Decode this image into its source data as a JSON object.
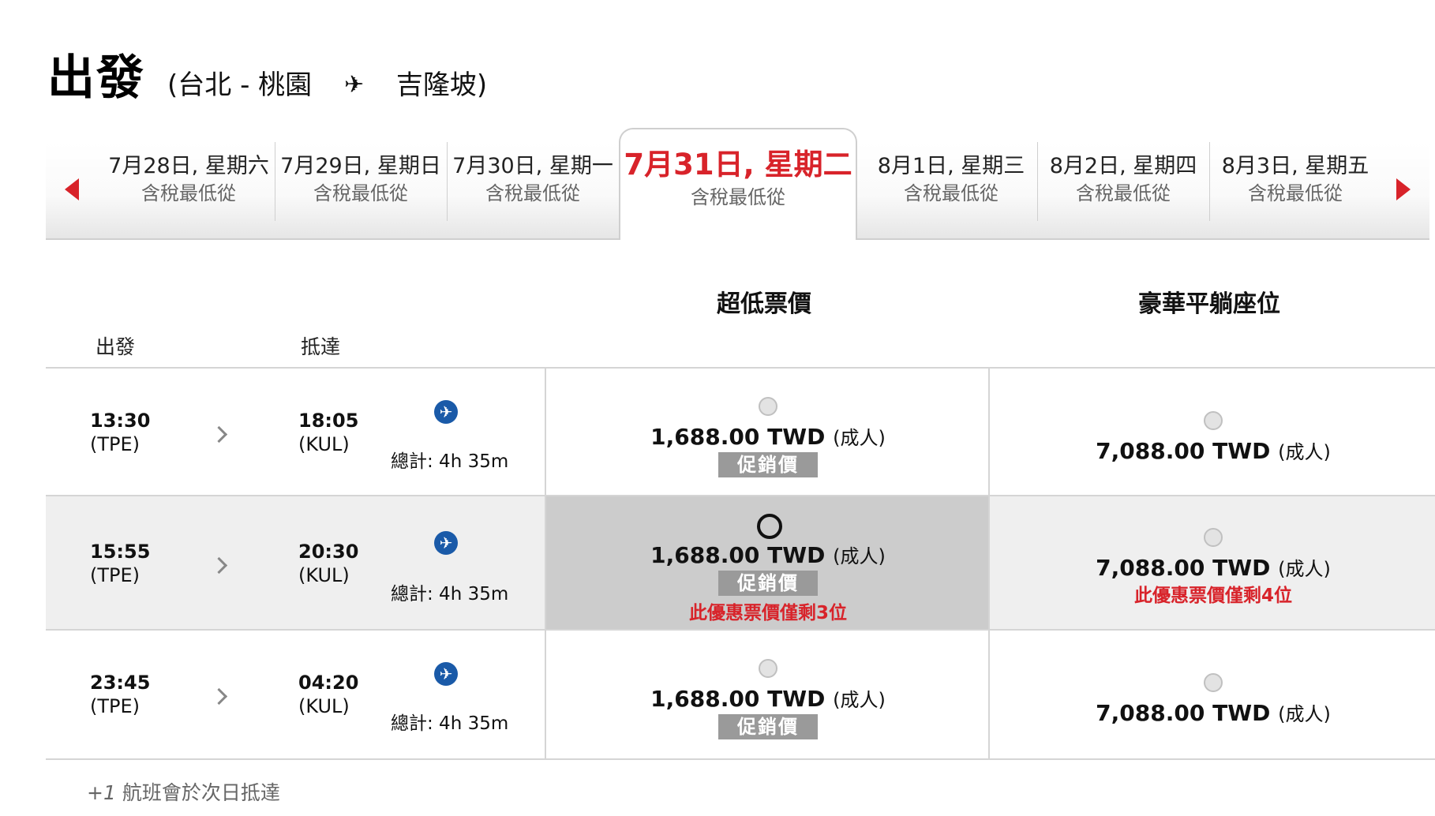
{
  "header": {
    "title": "出發",
    "route_from": "(台北 - 桃園",
    "route_to": "吉隆坡)"
  },
  "date_strip": {
    "days": [
      {
        "date": "7月28日, 星期六",
        "sub": "含稅最低從"
      },
      {
        "date": "7月29日, 星期日",
        "sub": "含稅最低從"
      },
      {
        "date": "7月30日, 星期一",
        "sub": "含稅最低從"
      },
      {
        "date": "7月31日, 星期二",
        "sub": "含稅最低從"
      },
      {
        "date": "8月1日, 星期三",
        "sub": "含稅最低從"
      },
      {
        "date": "8月2日, 星期四",
        "sub": "含稅最低從"
      },
      {
        "date": "8月3日, 星期五",
        "sub": "含稅最低從"
      }
    ],
    "selected_index": 3
  },
  "columns": {
    "depart": "出發",
    "arrive": "抵達",
    "fare1": "超低票價",
    "fare2": "豪華平躺座位"
  },
  "flights": [
    {
      "dep_time": "13:30",
      "dep_code": "(TPE)",
      "arr_time": "18:05",
      "arr_code": "(KUL)",
      "duration": "總計: 4h 35m",
      "fare1": {
        "price": "1,688.00 TWD",
        "unit": "(成人)",
        "promo": "促銷價",
        "seats_left": ""
      },
      "fare2": {
        "price": "7,088.00 TWD",
        "unit": "(成人)",
        "seats_left": ""
      }
    },
    {
      "dep_time": "15:55",
      "dep_code": "(TPE)",
      "arr_time": "20:30",
      "arr_code": "(KUL)",
      "duration": "總計: 4h 35m",
      "fare1": {
        "price": "1,688.00 TWD",
        "unit": "(成人)",
        "promo": "促銷價",
        "seats_left": "此優惠票價僅剩3位"
      },
      "fare2": {
        "price": "7,088.00 TWD",
        "unit": "(成人)",
        "seats_left": "此優惠票價僅剩4位"
      }
    },
    {
      "dep_time": "23:45",
      "dep_code": "(TPE)",
      "arr_time": "04:20",
      "arr_code": "(KUL)",
      "duration": "總計: 4h 35m",
      "fare1": {
        "price": "1,688.00 TWD",
        "unit": "(成人)",
        "promo": "促銷價",
        "seats_left": ""
      },
      "fare2": {
        "price": "7,088.00 TWD",
        "unit": "(成人)",
        "seats_left": ""
      }
    }
  ],
  "footnote": {
    "mark": "+1",
    "text": "航班會於次日抵達"
  },
  "colors": {
    "accent_red": "#d8232a",
    "airline_blue": "#1a5aa8",
    "promo_gray": "#9a9a9a"
  }
}
